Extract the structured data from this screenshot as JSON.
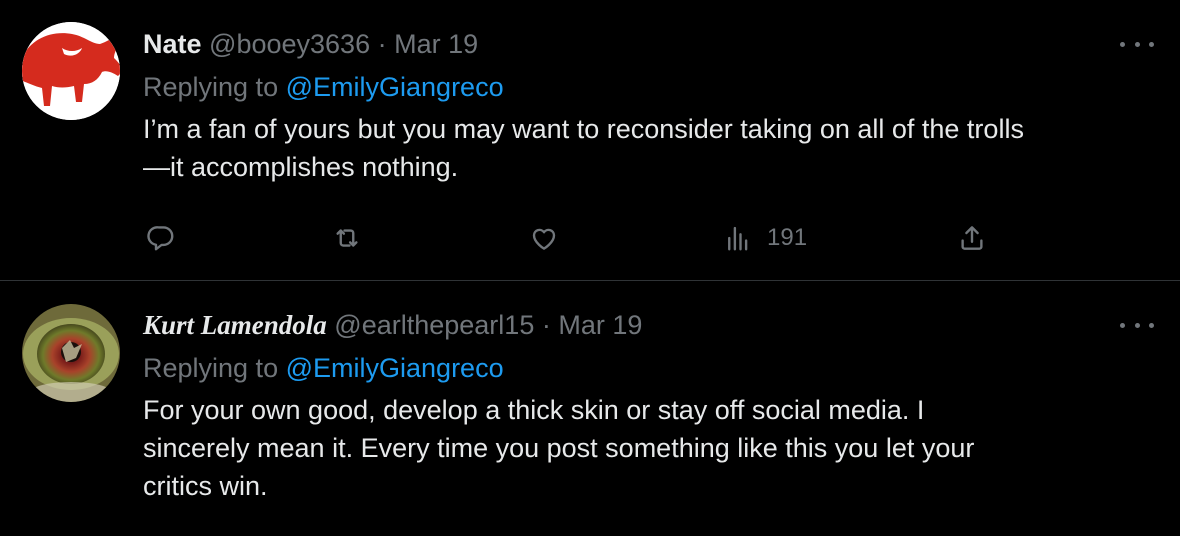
{
  "colors": {
    "background": "#000000",
    "text_primary": "#e7e9ea",
    "text_secondary": "#71767b",
    "link": "#1d9bf0",
    "divider": "#2f3336"
  },
  "tweets": [
    {
      "display_name": "Nate",
      "handle": "@booey3636",
      "separator": "·",
      "timestamp": "Mar 19",
      "reply_prefix": "Replying to",
      "reply_to": "@EmilyGiangreco",
      "text": "I’m a fan of yours but you may want to reconsider taking on all of the trolls\n—it accomplishes nothing.",
      "avatar_icon": "red-bison-logo",
      "actions": {
        "reply_icon": "reply-icon",
        "retweet_icon": "retweet-icon",
        "like_icon": "heart-icon",
        "views_icon": "views-icon",
        "views_count": "191",
        "share_icon": "share-icon"
      },
      "more_icon": "more-options-icon"
    },
    {
      "display_name": "Kurt Lamendola",
      "handle": "@earlthepearl15",
      "separator": "·",
      "timestamp": "Mar 19",
      "reply_prefix": "Replying to",
      "reply_to": "@EmilyGiangreco",
      "text": "For your own good, develop a thick skin or stay off social media. I\nsincerely mean it. Every time you post something like this you let your\ncritics win.",
      "avatar_icon": "eye-photo-avatar",
      "more_icon": "more-options-icon"
    }
  ]
}
